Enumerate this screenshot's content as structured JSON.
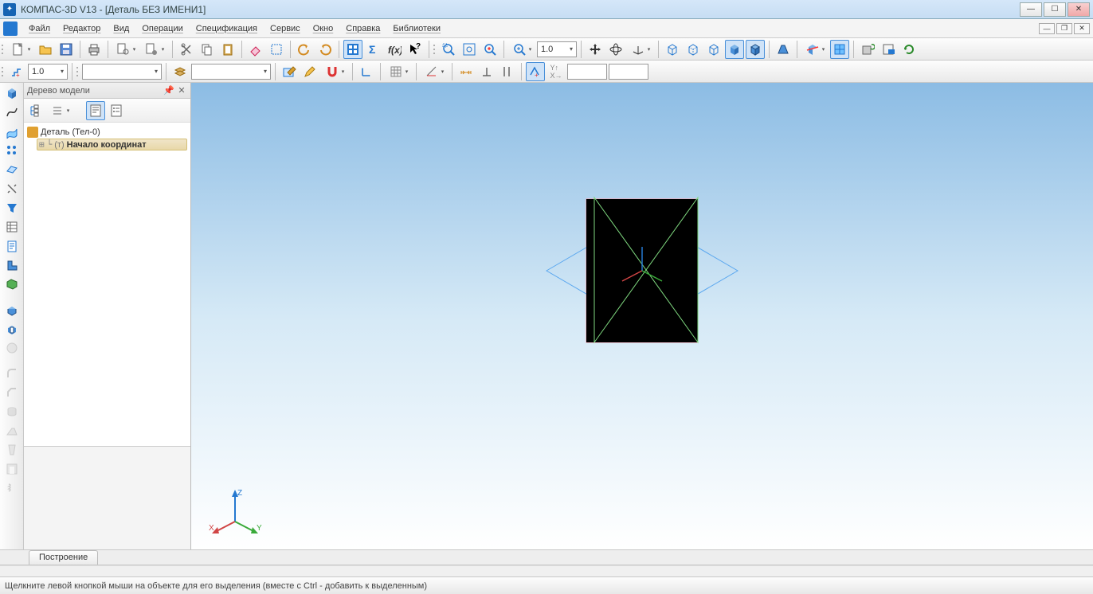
{
  "window": {
    "title": "КОМПАС-3D V13 - [Деталь БЕЗ ИМЕНИ1]"
  },
  "menu": {
    "items": [
      "Файл",
      "Редактор",
      "Вид",
      "Операции",
      "Спецификация",
      "Сервис",
      "Окно",
      "Справка",
      "Библиотеки"
    ]
  },
  "toolbar1": {
    "stepCombo": "1.0",
    "scaleCombo": "1.0"
  },
  "toolbar2": {
    "stepCombo": "1.0"
  },
  "tree": {
    "title": "Дерево модели",
    "root": "Деталь (Тел-0)",
    "child1_prefix": "(т)",
    "child1": "Начало координат"
  },
  "tabs": {
    "tab1": "Построение"
  },
  "status": {
    "hint": "Щелкните левой кнопкой мыши на объекте для его выделения (вместе с Ctrl - добавить к выделенным)"
  },
  "triad": {
    "x": "X",
    "y": "Y",
    "z": "Z"
  }
}
